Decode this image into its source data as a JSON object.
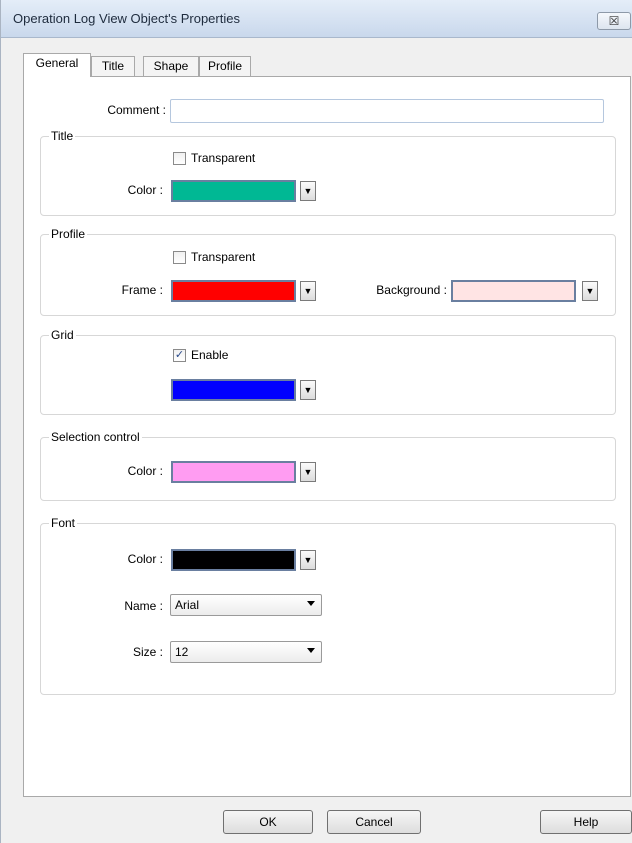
{
  "window": {
    "title": "Operation Log View Object's Properties",
    "close_glyph": "☒"
  },
  "tabs": [
    "General",
    "Title",
    "Shape",
    "Profile"
  ],
  "comment": {
    "label": "Comment :",
    "value": ""
  },
  "title_group": {
    "label": "Title",
    "transparent_label": "Transparent",
    "transparent_checked": false,
    "color_label": "Color :",
    "color": "#00b894"
  },
  "profile_group": {
    "label": "Profile",
    "transparent_label": "Transparent",
    "transparent_checked": false,
    "frame_label": "Frame :",
    "frame_color": "#ff0000",
    "background_label": "Background :",
    "background_color": "#ffe4e4"
  },
  "grid_group": {
    "label": "Grid",
    "enable_label": "Enable",
    "enable_checked": true,
    "check_glyph": "✓",
    "color": "#0000ff"
  },
  "selection_group": {
    "label": "Selection control",
    "color_label": "Color :",
    "color": "#ff9cf2"
  },
  "font_group": {
    "label": "Font",
    "color_label": "Color :",
    "color": "#000000",
    "name_label": "Name :",
    "name_value": "Arial",
    "size_label": "Size :",
    "size_value": "12"
  },
  "buttons": {
    "ok": "OK",
    "cancel": "Cancel",
    "help": "Help"
  },
  "dropdown_glyph": "▼"
}
